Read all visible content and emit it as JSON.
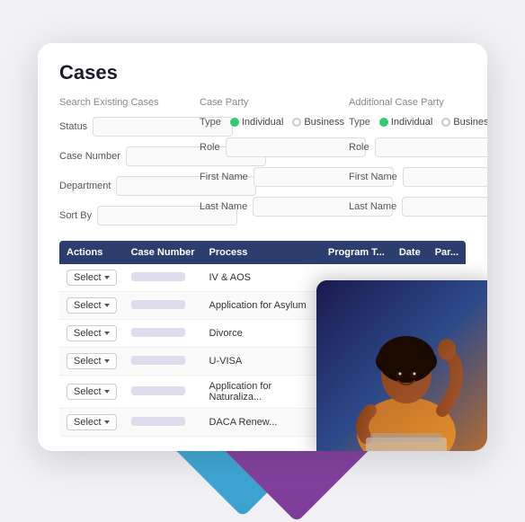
{
  "page": {
    "title": "Cases"
  },
  "search_section": {
    "label": "Search Existing Cases",
    "fields": [
      {
        "label": "Status",
        "value": ""
      },
      {
        "label": "Case Number",
        "value": ""
      },
      {
        "label": "Department",
        "value": ""
      },
      {
        "label": "Sort By",
        "value": ""
      }
    ]
  },
  "case_party": {
    "label": "Case Party",
    "type_label": "Type",
    "type_options": [
      "Individual",
      "Business"
    ],
    "type_selected": "Individual",
    "role_label": "Role",
    "role_value": "",
    "first_name_label": "First Name",
    "first_name_value": "",
    "last_name_label": "Last Name",
    "last_name_value": ""
  },
  "additional_case_party": {
    "label": "Additional Case Party",
    "type_label": "Type",
    "type_options": [
      "Individual",
      "Business"
    ],
    "type_selected": "Individual",
    "role_label": "Role",
    "role_value": "",
    "first_name_label": "First Name",
    "first_name_value": "",
    "last_name_label": "Last Name",
    "last_name_value": ""
  },
  "table": {
    "columns": [
      "Actions",
      "Case Number",
      "Process",
      "Program T...",
      "Date",
      "Par..."
    ],
    "rows": [
      {
        "action": "Select",
        "case_number": "",
        "process": "IV & AOS"
      },
      {
        "action": "Select",
        "case_number": "",
        "process": "Application for Asylum"
      },
      {
        "action": "Select",
        "case_number": "",
        "process": "Divorce"
      },
      {
        "action": "Select",
        "case_number": "",
        "process": "U-VISA"
      },
      {
        "action": "Select",
        "case_number": "",
        "process": "Application for Naturaliza..."
      },
      {
        "action": "Select",
        "case_number": "",
        "process": "DACA Renew..."
      }
    ]
  },
  "icons": {
    "chevron_down": "▾"
  }
}
